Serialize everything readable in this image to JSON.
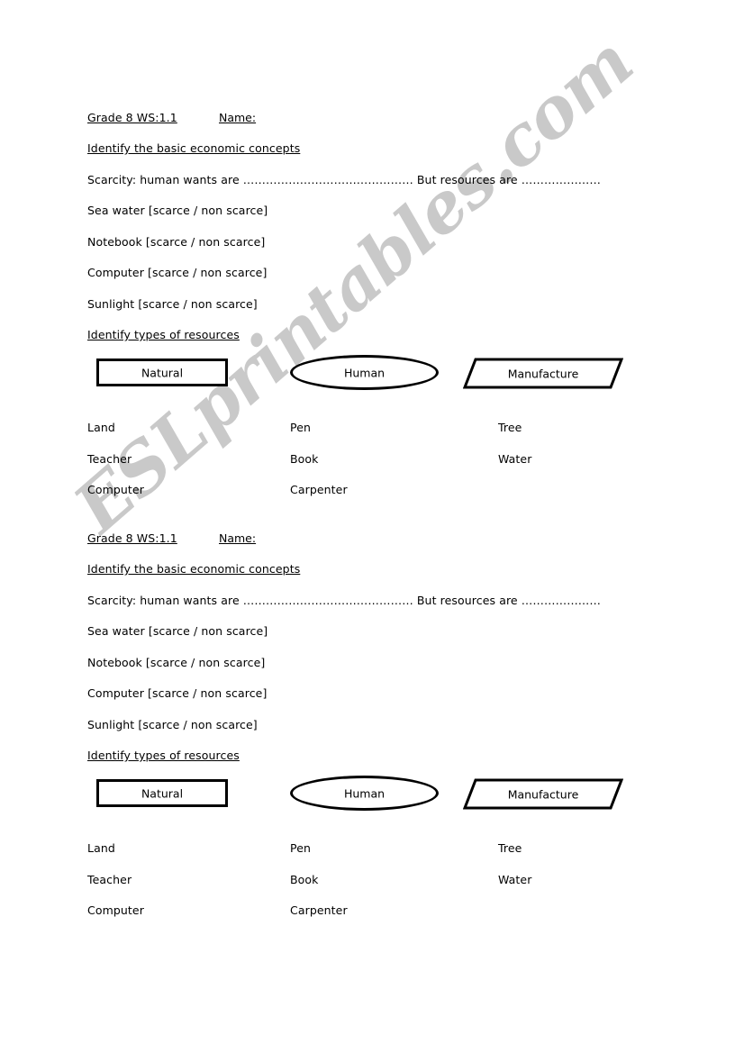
{
  "document": {
    "title": "Grade 8 WS:1.1 Economics Worksheet",
    "watermark": "ESLprintables.com",
    "watermark_color": "#c9c9c9",
    "page_background": "#ffffff",
    "text_color": "#000000"
  },
  "worksheet": {
    "header": {
      "grade_label": "Grade 8 WS:1.1",
      "name_label": "Name:"
    },
    "section1": {
      "heading": "Identify the basic economic concepts",
      "scarcity_line": "Scarcity: human wants are ……………………………………… But resources are …………………",
      "items": [
        "Sea water [scarce / non scarce]",
        "Notebook [scarce / non scarce]",
        "Computer [scarce / non scarce]",
        "Sunlight [scarce / non scarce]"
      ]
    },
    "section2": {
      "heading": "Identify types of resources",
      "categories": [
        {
          "label": "Natural",
          "shape": "rectangle"
        },
        {
          "label": "Human",
          "shape": "ellipse"
        },
        {
          "label": "Manufacture",
          "shape": "parallelogram"
        }
      ],
      "word_columns": [
        [
          "Land",
          "Teacher",
          "Computer"
        ],
        [
          "Pen",
          "Book",
          "Carpenter"
        ],
        [
          "Tree",
          "Water"
        ]
      ]
    }
  }
}
